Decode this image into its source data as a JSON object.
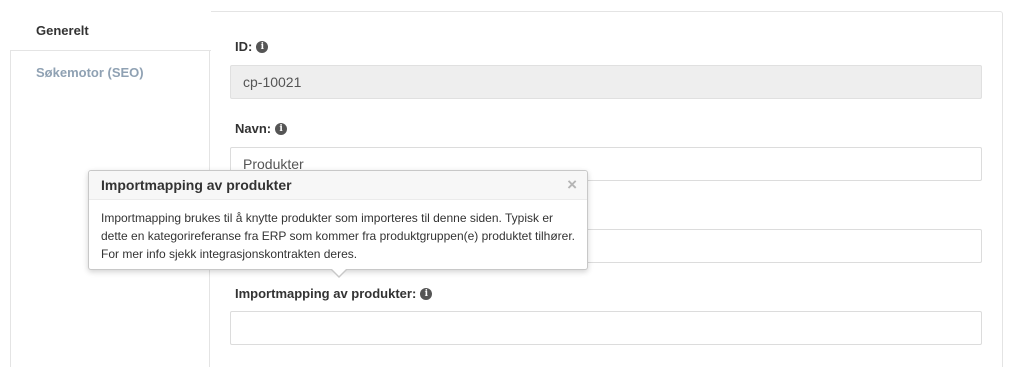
{
  "tabs": [
    {
      "label": "Generelt",
      "active": true
    },
    {
      "label": "Søkemotor (SEO)",
      "active": false
    }
  ],
  "fields": {
    "id": {
      "label": "ID:",
      "value": "cp-10021"
    },
    "name": {
      "label": "Navn:",
      "value": "Produkter"
    },
    "hidden_field": {
      "value": ""
    },
    "import_mapping": {
      "label": "Importmapping av produkter:",
      "value": ""
    }
  },
  "popover": {
    "title": "Importmapping av produkter",
    "close_glyph": "×",
    "body_lines": [
      "Importmapping brukes til å knytte produkter som importeres til denne siden. Typisk er",
      "dette en kategorireferanse fra ERP som kommer fra produktgruppen(e) produktet tilhører.",
      "For mer info sjekk integrasjonskontrakten deres."
    ]
  },
  "icons": {
    "info": "info-circle-icon",
    "info_glyph": "i"
  },
  "colors": {
    "inactive_tab": "#8fa1b3",
    "readonly_bg": "#eeeeee",
    "icon_bg": "#555555"
  }
}
